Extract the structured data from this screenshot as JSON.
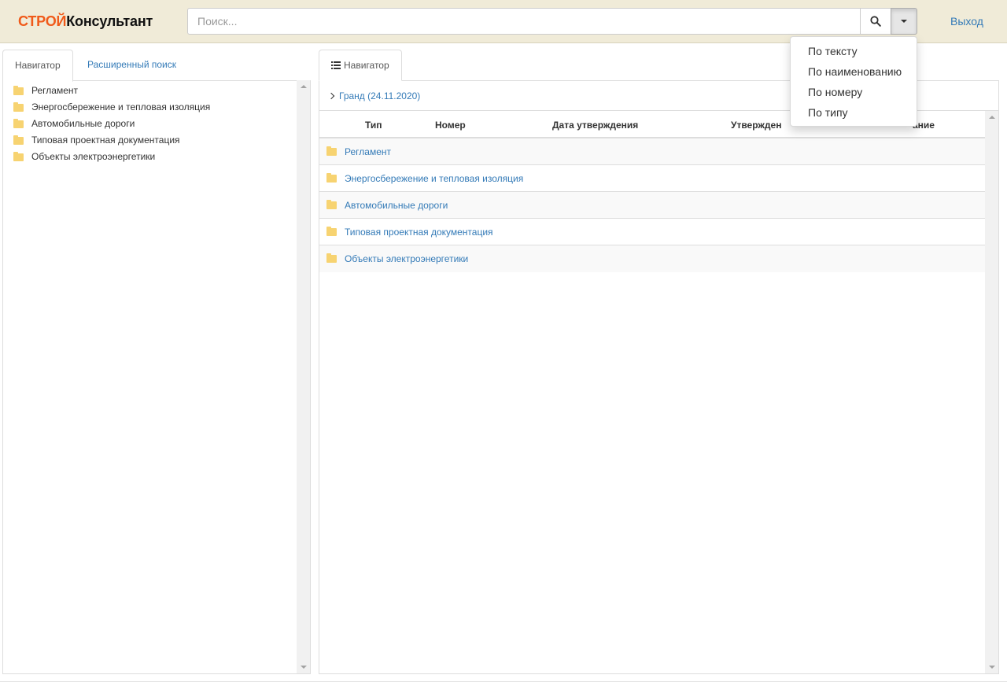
{
  "header": {
    "logo_part1": "СТРОЙ",
    "logo_part2": "Консультант",
    "search_placeholder": "Поиск...",
    "logout_label": "Выход"
  },
  "search_dropdown": {
    "items": [
      "По тексту",
      "По наименованию",
      "По номеру",
      "По типу"
    ]
  },
  "left_tabs": {
    "active": "Навигатор",
    "advanced": "Расширенный поиск"
  },
  "tree": {
    "items": [
      "Регламент",
      "Энергосбережение и тепловая изоляция",
      "Автомобильные дороги",
      "Типовая проектная документация",
      "Объекты электроэнергетики"
    ]
  },
  "right_tab": {
    "label": "Навигатор",
    "icon": "list-icon"
  },
  "breadcrumb": {
    "label": "Гранд (24.11.2020)"
  },
  "grid": {
    "columns": [
      "Тип",
      "Номер",
      "Дата утверждения",
      "Утвержден",
      "ание"
    ],
    "rows": [
      "Регламент",
      "Энергосбережение и тепловая изоляция",
      "Автомобильные дороги",
      "Типовая проектная документация",
      "Объекты электроэнергетики"
    ]
  },
  "colors": {
    "header_bg": "#f0ebd8",
    "logo_accent": "#f05a1a",
    "link": "#337ab7",
    "folder": "#f7d371"
  }
}
